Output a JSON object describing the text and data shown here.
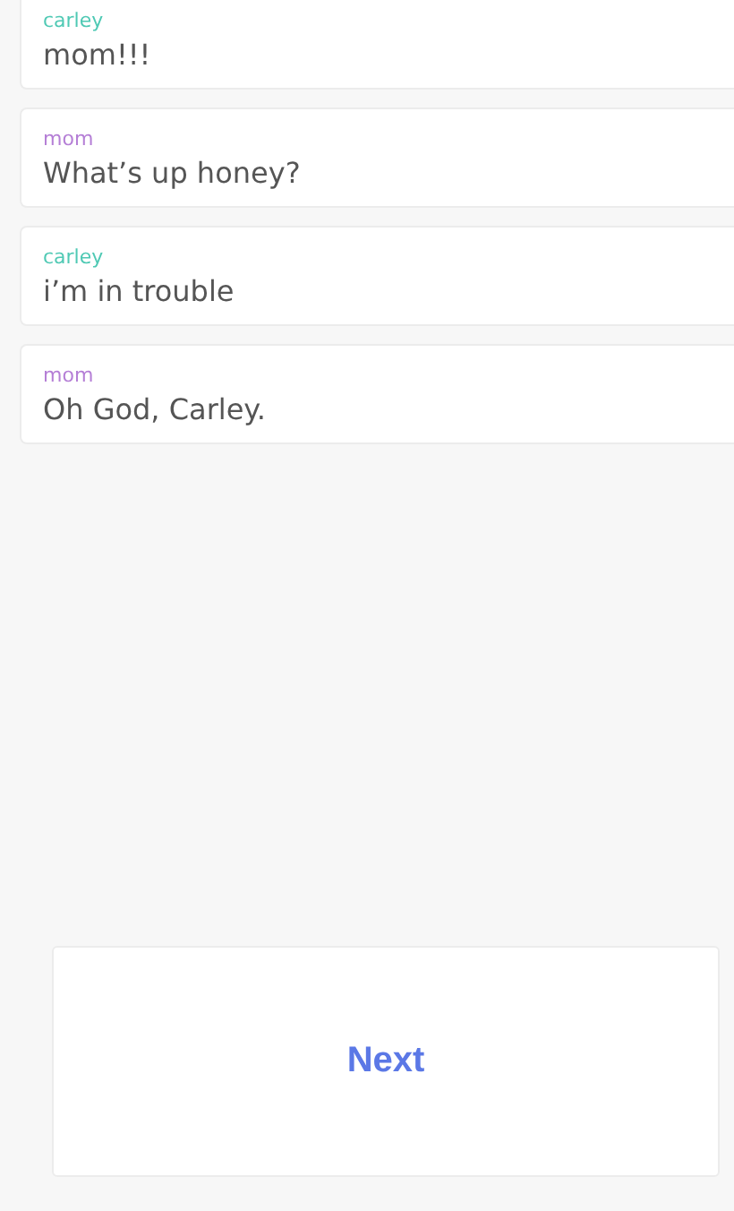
{
  "messages": [
    {
      "sender": "carley",
      "text": "mom!!!",
      "color": "#4fc9b4"
    },
    {
      "sender": "mom",
      "text": "What’s up honey?",
      "color": "#b57fd6"
    },
    {
      "sender": "carley",
      "text": "i’m in trouble",
      "color": "#4fc9b4"
    },
    {
      "sender": "mom",
      "text": "Oh God, Carley.",
      "color": "#b57fd6"
    }
  ],
  "next_button": "Next"
}
